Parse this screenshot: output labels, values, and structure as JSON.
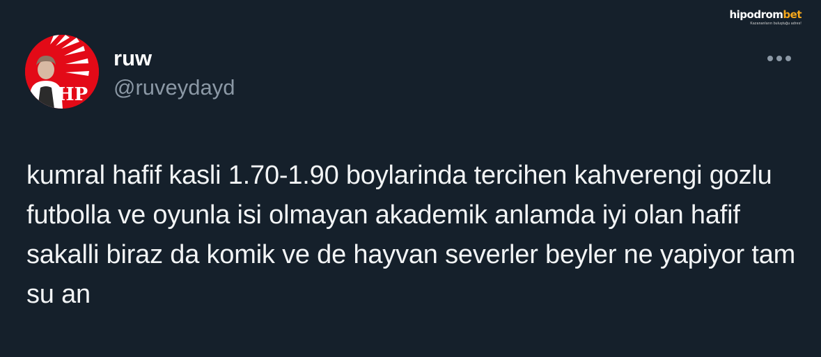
{
  "watermark": {
    "brand_main": "hipodrom",
    "brand_accent": "bet",
    "tagline": "Kazananların buluştuğu adres!"
  },
  "author": {
    "display_name": "ruw",
    "handle": "@ruveydayd",
    "avatar_text": "HP"
  },
  "tweet": {
    "text": "kumral hafif kasli 1.70-1.90 boylarinda tercihen kahverengi gozlu futbolla ve oyunla isi olmayan akademik anlamda iyi olan hafif sakalli biraz da komik ve de hayvan severler beyler ne yapiyor tam su an"
  },
  "icons": {
    "more": "more-horizontal-icon"
  },
  "colors": {
    "background": "#15202b",
    "text_primary": "#ffffff",
    "text_secondary": "#8b98a5",
    "avatar_red": "#e30a17",
    "watermark_accent": "#f6a81c"
  }
}
